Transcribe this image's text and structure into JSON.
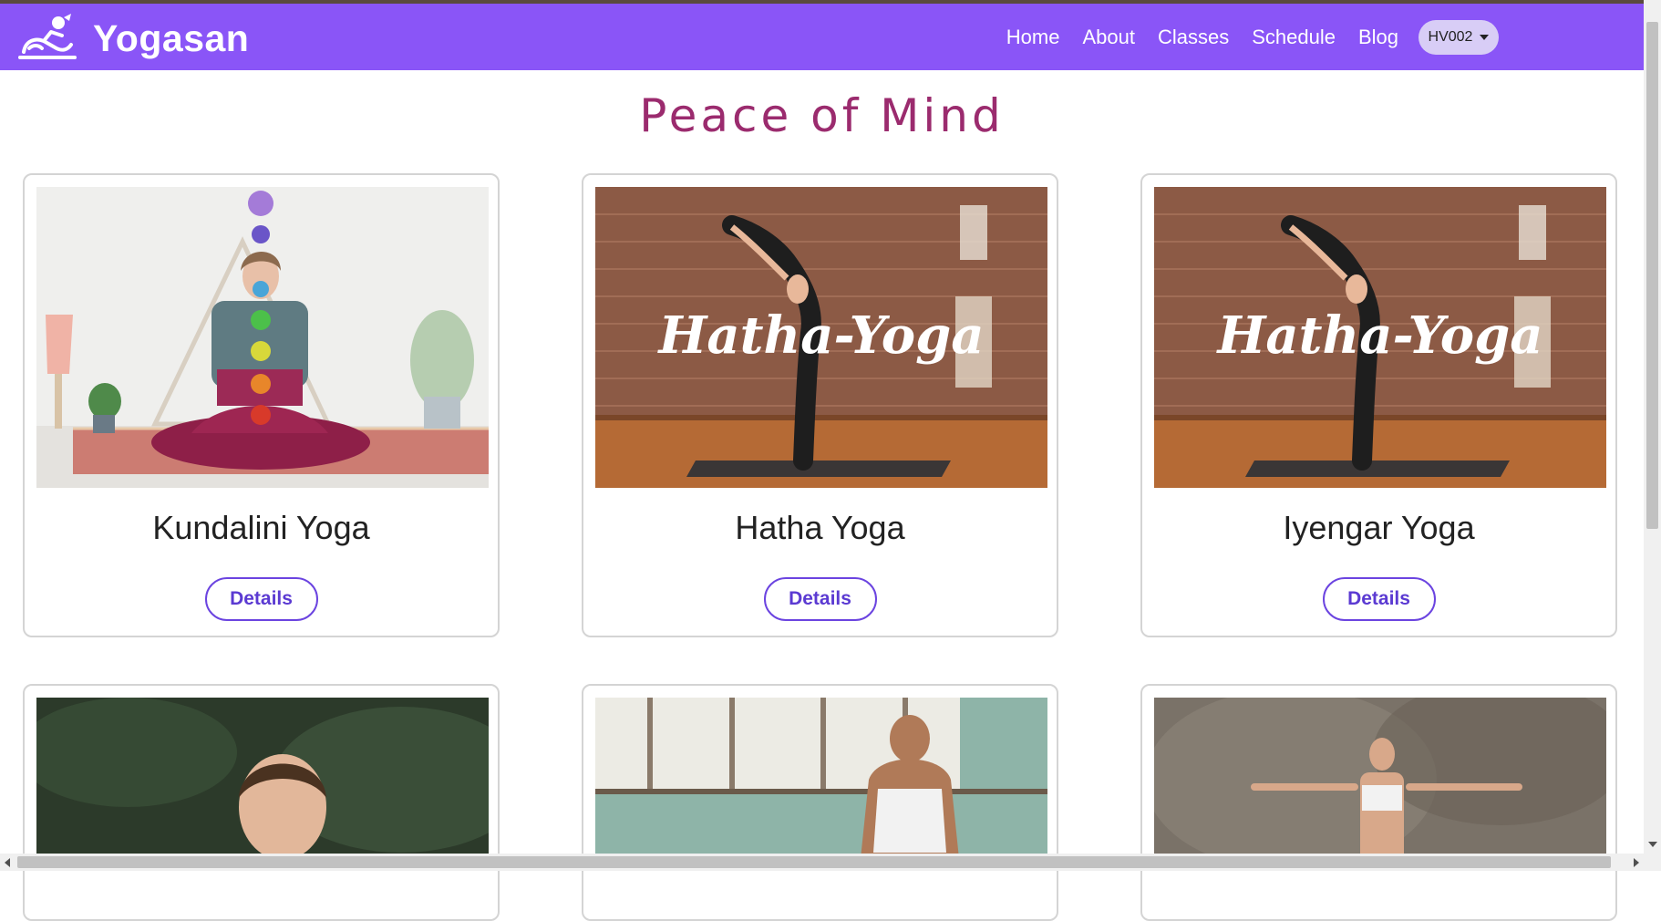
{
  "brand": {
    "name": "Yogasan"
  },
  "nav": {
    "links": [
      "Home",
      "About",
      "Classes",
      "Schedule",
      "Blog"
    ],
    "user": "HV002"
  },
  "page": {
    "title": "Peace of Mind"
  },
  "cards": [
    {
      "title": "Kundalini Yoga",
      "button": "Details"
    },
    {
      "title": "Hatha Yoga",
      "button": "Details",
      "image_text": "Hatha-Yoga"
    },
    {
      "title": "Iyengar Yoga",
      "button": "Details",
      "image_text": "Hatha-Yoga"
    }
  ],
  "colors": {
    "navbar": "#8a55f7",
    "title": "#9b2b6e",
    "button_border": "#6b44e0"
  }
}
